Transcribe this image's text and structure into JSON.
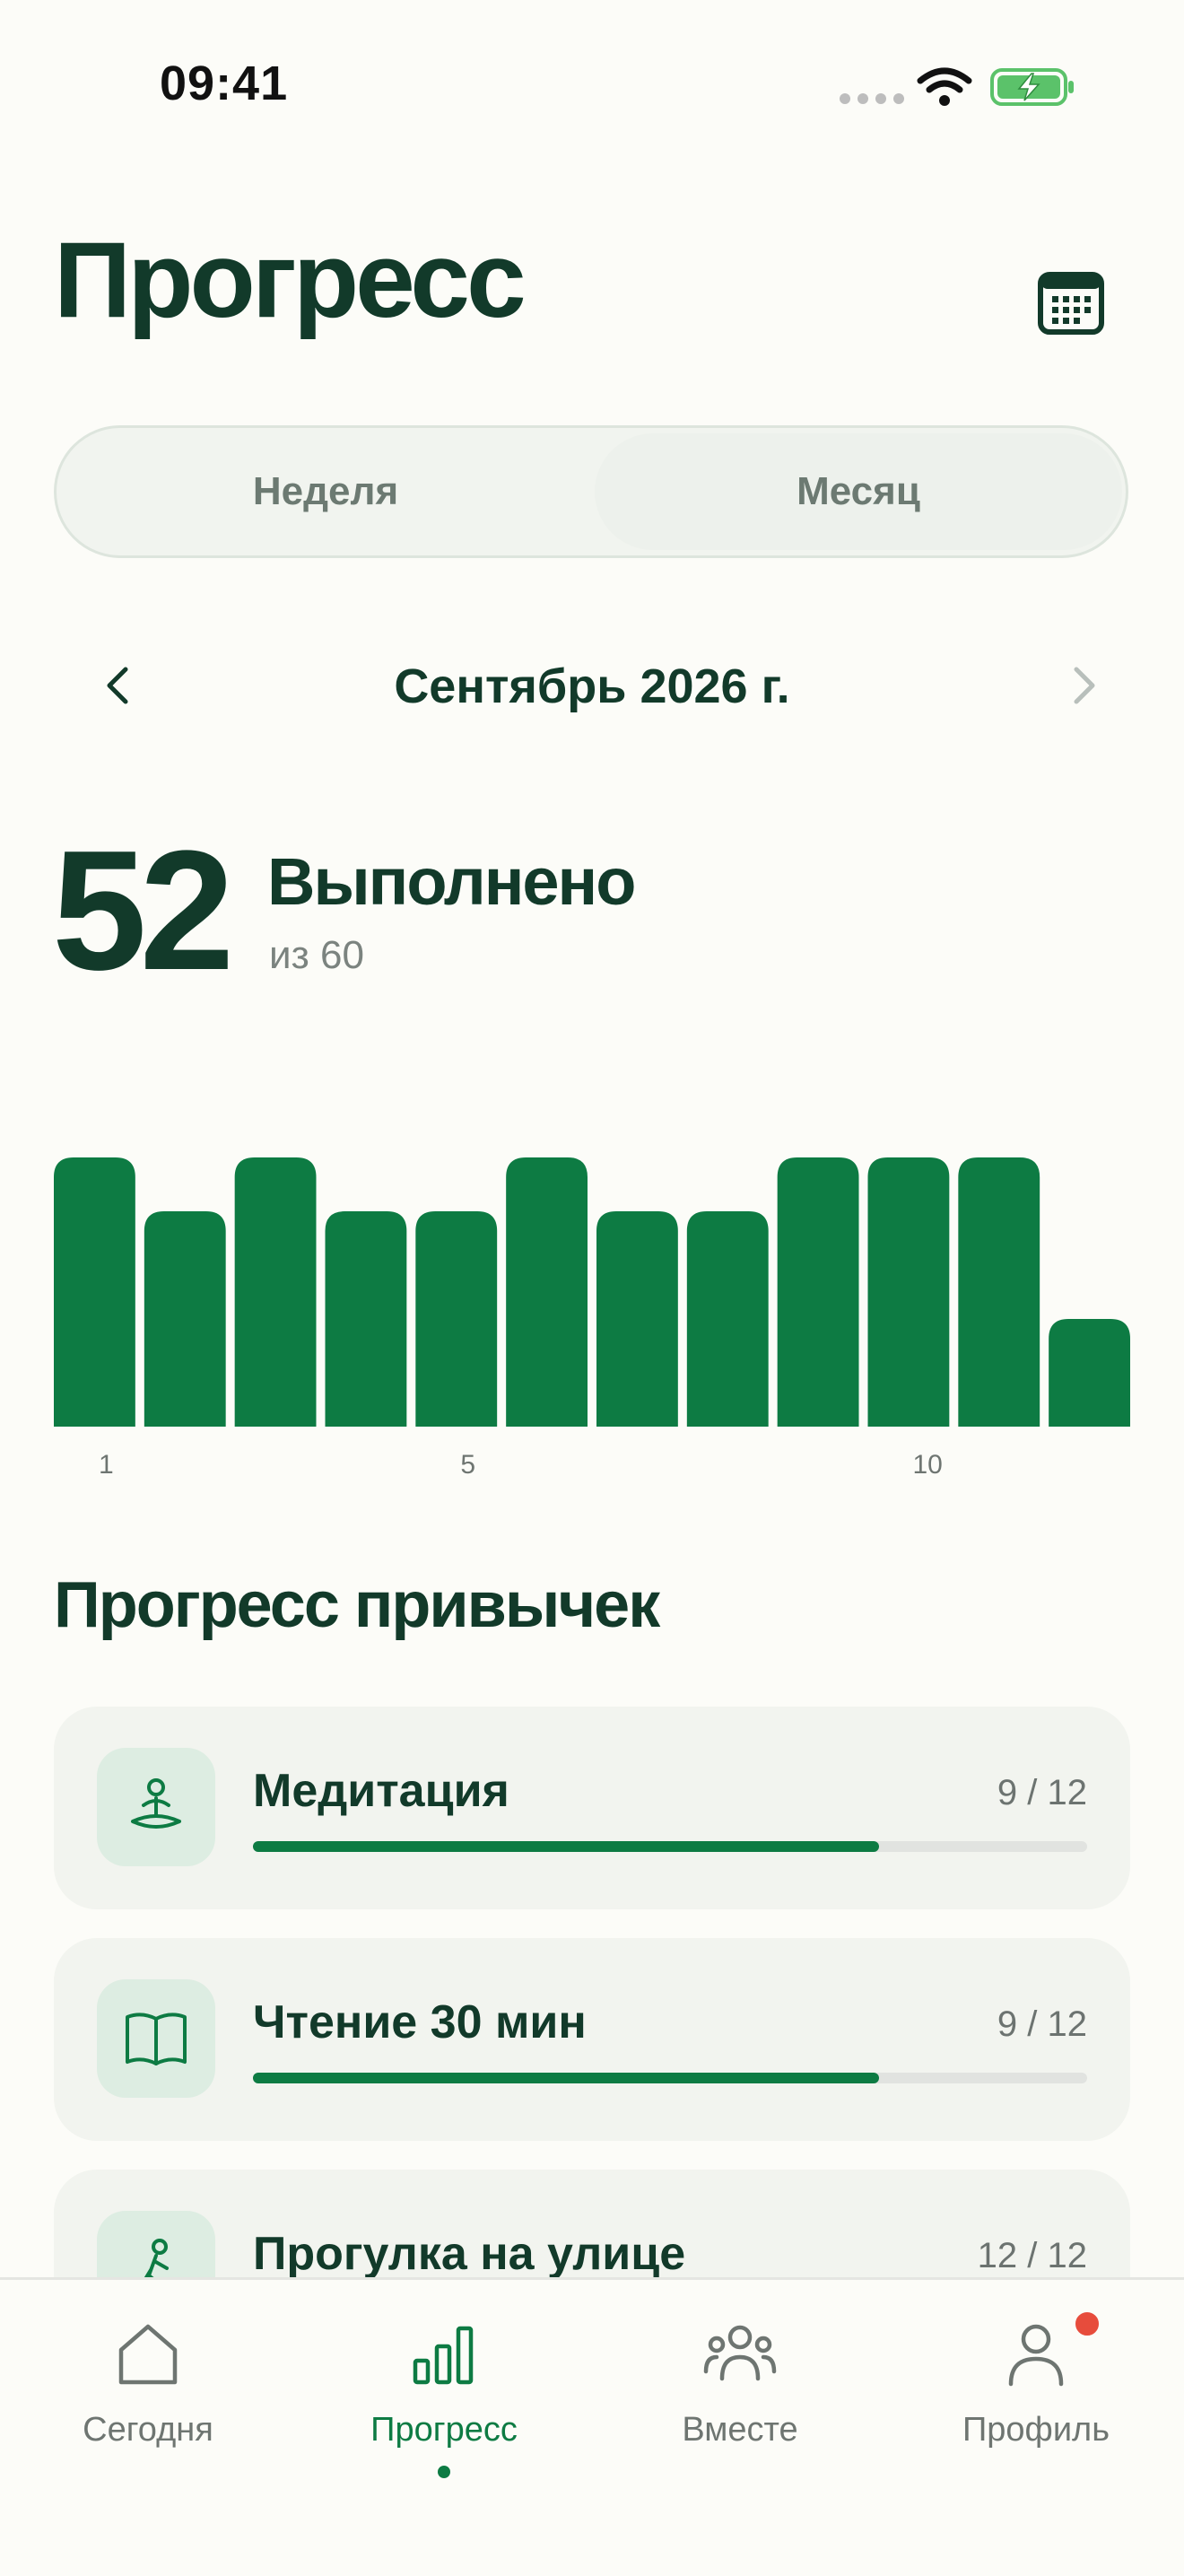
{
  "status_bar": {
    "time": "09:41"
  },
  "header": {
    "title": "Прогресс"
  },
  "segments": {
    "week": "Неделя",
    "month": "Месяц",
    "selected": "month"
  },
  "period": {
    "label": "Сентябрь 2026 г."
  },
  "summary": {
    "done": "52",
    "done_label": "Выполнено",
    "total_label": "из 60"
  },
  "chart_data": {
    "type": "bar",
    "categories": [
      "1",
      "2",
      "3",
      "4",
      "5",
      "6",
      "7",
      "8",
      "9",
      "10",
      "11",
      "12"
    ],
    "values": [
      5,
      4,
      5,
      4,
      4,
      5,
      4,
      4,
      5,
      5,
      5,
      2
    ],
    "tick_labels": [
      {
        "index": 0,
        "text": "1"
      },
      {
        "index": 4,
        "text": "5"
      },
      {
        "index": 9,
        "text": "10"
      }
    ],
    "ylim": [
      0,
      5
    ],
    "color": "#0D7B43",
    "grid": false
  },
  "habits_section": {
    "title": "Прогресс привычек"
  },
  "habits": [
    {
      "name": "Медитация",
      "count": "9 / 12",
      "progress": 0.75,
      "icon": "meditation-icon"
    },
    {
      "name": "Чтение 30 мин",
      "count": "9 / 12",
      "progress": 0.75,
      "icon": "book-icon"
    },
    {
      "name": "Прогулка на улице",
      "count": "12 / 12",
      "progress": 1.0,
      "icon": "walking-icon"
    }
  ],
  "tabs": [
    {
      "label": "Сегодня",
      "icon": "home-icon"
    },
    {
      "label": "Прогресс",
      "icon": "bar-chart-icon",
      "active": true
    },
    {
      "label": "Вместе",
      "icon": "people-icon"
    },
    {
      "label": "Профиль",
      "icon": "person-icon",
      "badge": true
    }
  ],
  "colors": {
    "accent": "#0D7B43",
    "title": "#123A2A",
    "background": "#FCFCF8",
    "badge": "#E74C3C"
  }
}
